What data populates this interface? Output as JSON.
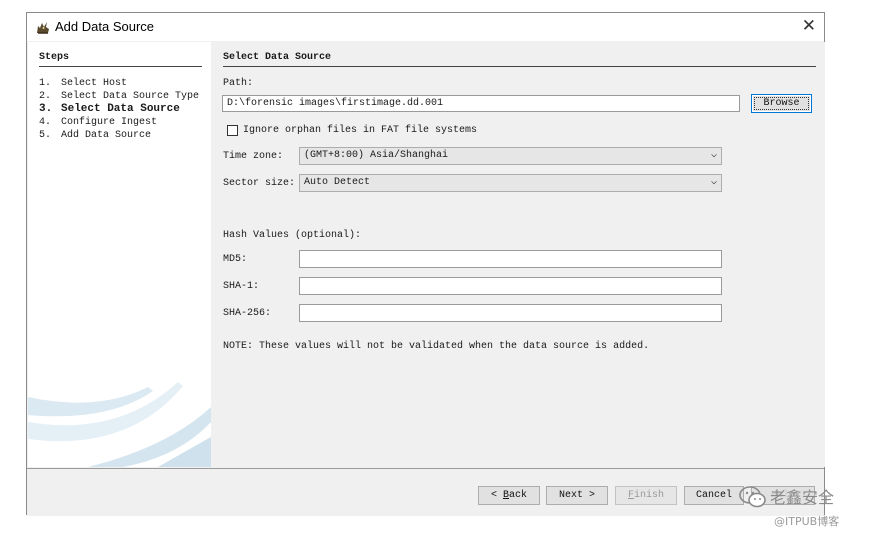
{
  "window": {
    "title": "Add Data Source",
    "close_glyph": "✕"
  },
  "steps": {
    "heading": "Steps",
    "items": [
      {
        "num": "1.",
        "label": "Select Host"
      },
      {
        "num": "2.",
        "label": "Select Data Source Type"
      },
      {
        "num": "3.",
        "label": "Select Data Source"
      },
      {
        "num": "4.",
        "label": "Configure Ingest"
      },
      {
        "num": "5.",
        "label": "Add Data Source"
      }
    ],
    "current_index": 2
  },
  "form": {
    "heading": "Select Data Source",
    "path_label": "Path:",
    "path_value": "D:\\forensic images\\firstimage.dd.001",
    "browse_label": "Browse",
    "ignore_orphan_label": "Ignore orphan files in FAT file systems",
    "ignore_orphan_checked": false,
    "timezone_label": "Time zone:",
    "timezone_value": "(GMT+8:00) Asia/Shanghai",
    "sector_label": "Sector size:",
    "sector_value": "Auto Detect",
    "chevron_glyph": "⌵",
    "hash_heading": "Hash Values (optional):",
    "md5_label": "MD5:",
    "md5_value": "",
    "sha1_label": "SHA-1:",
    "sha1_value": "",
    "sha256_label": "SHA-256:",
    "sha256_value": "",
    "note": "NOTE: These values will not be validated when the data source is added."
  },
  "footer": {
    "back_label": "< Back",
    "next_label": "Next >",
    "finish_label": "Finish",
    "cancel_label": "Cancel",
    "help_label": "Help"
  },
  "watermark": {
    "main": "老鑫安全",
    "sub": "@ITPUB博客"
  },
  "colors": {
    "accent": "#0078d7",
    "panel_bg": "#f0f0f0",
    "white": "#ffffff"
  }
}
